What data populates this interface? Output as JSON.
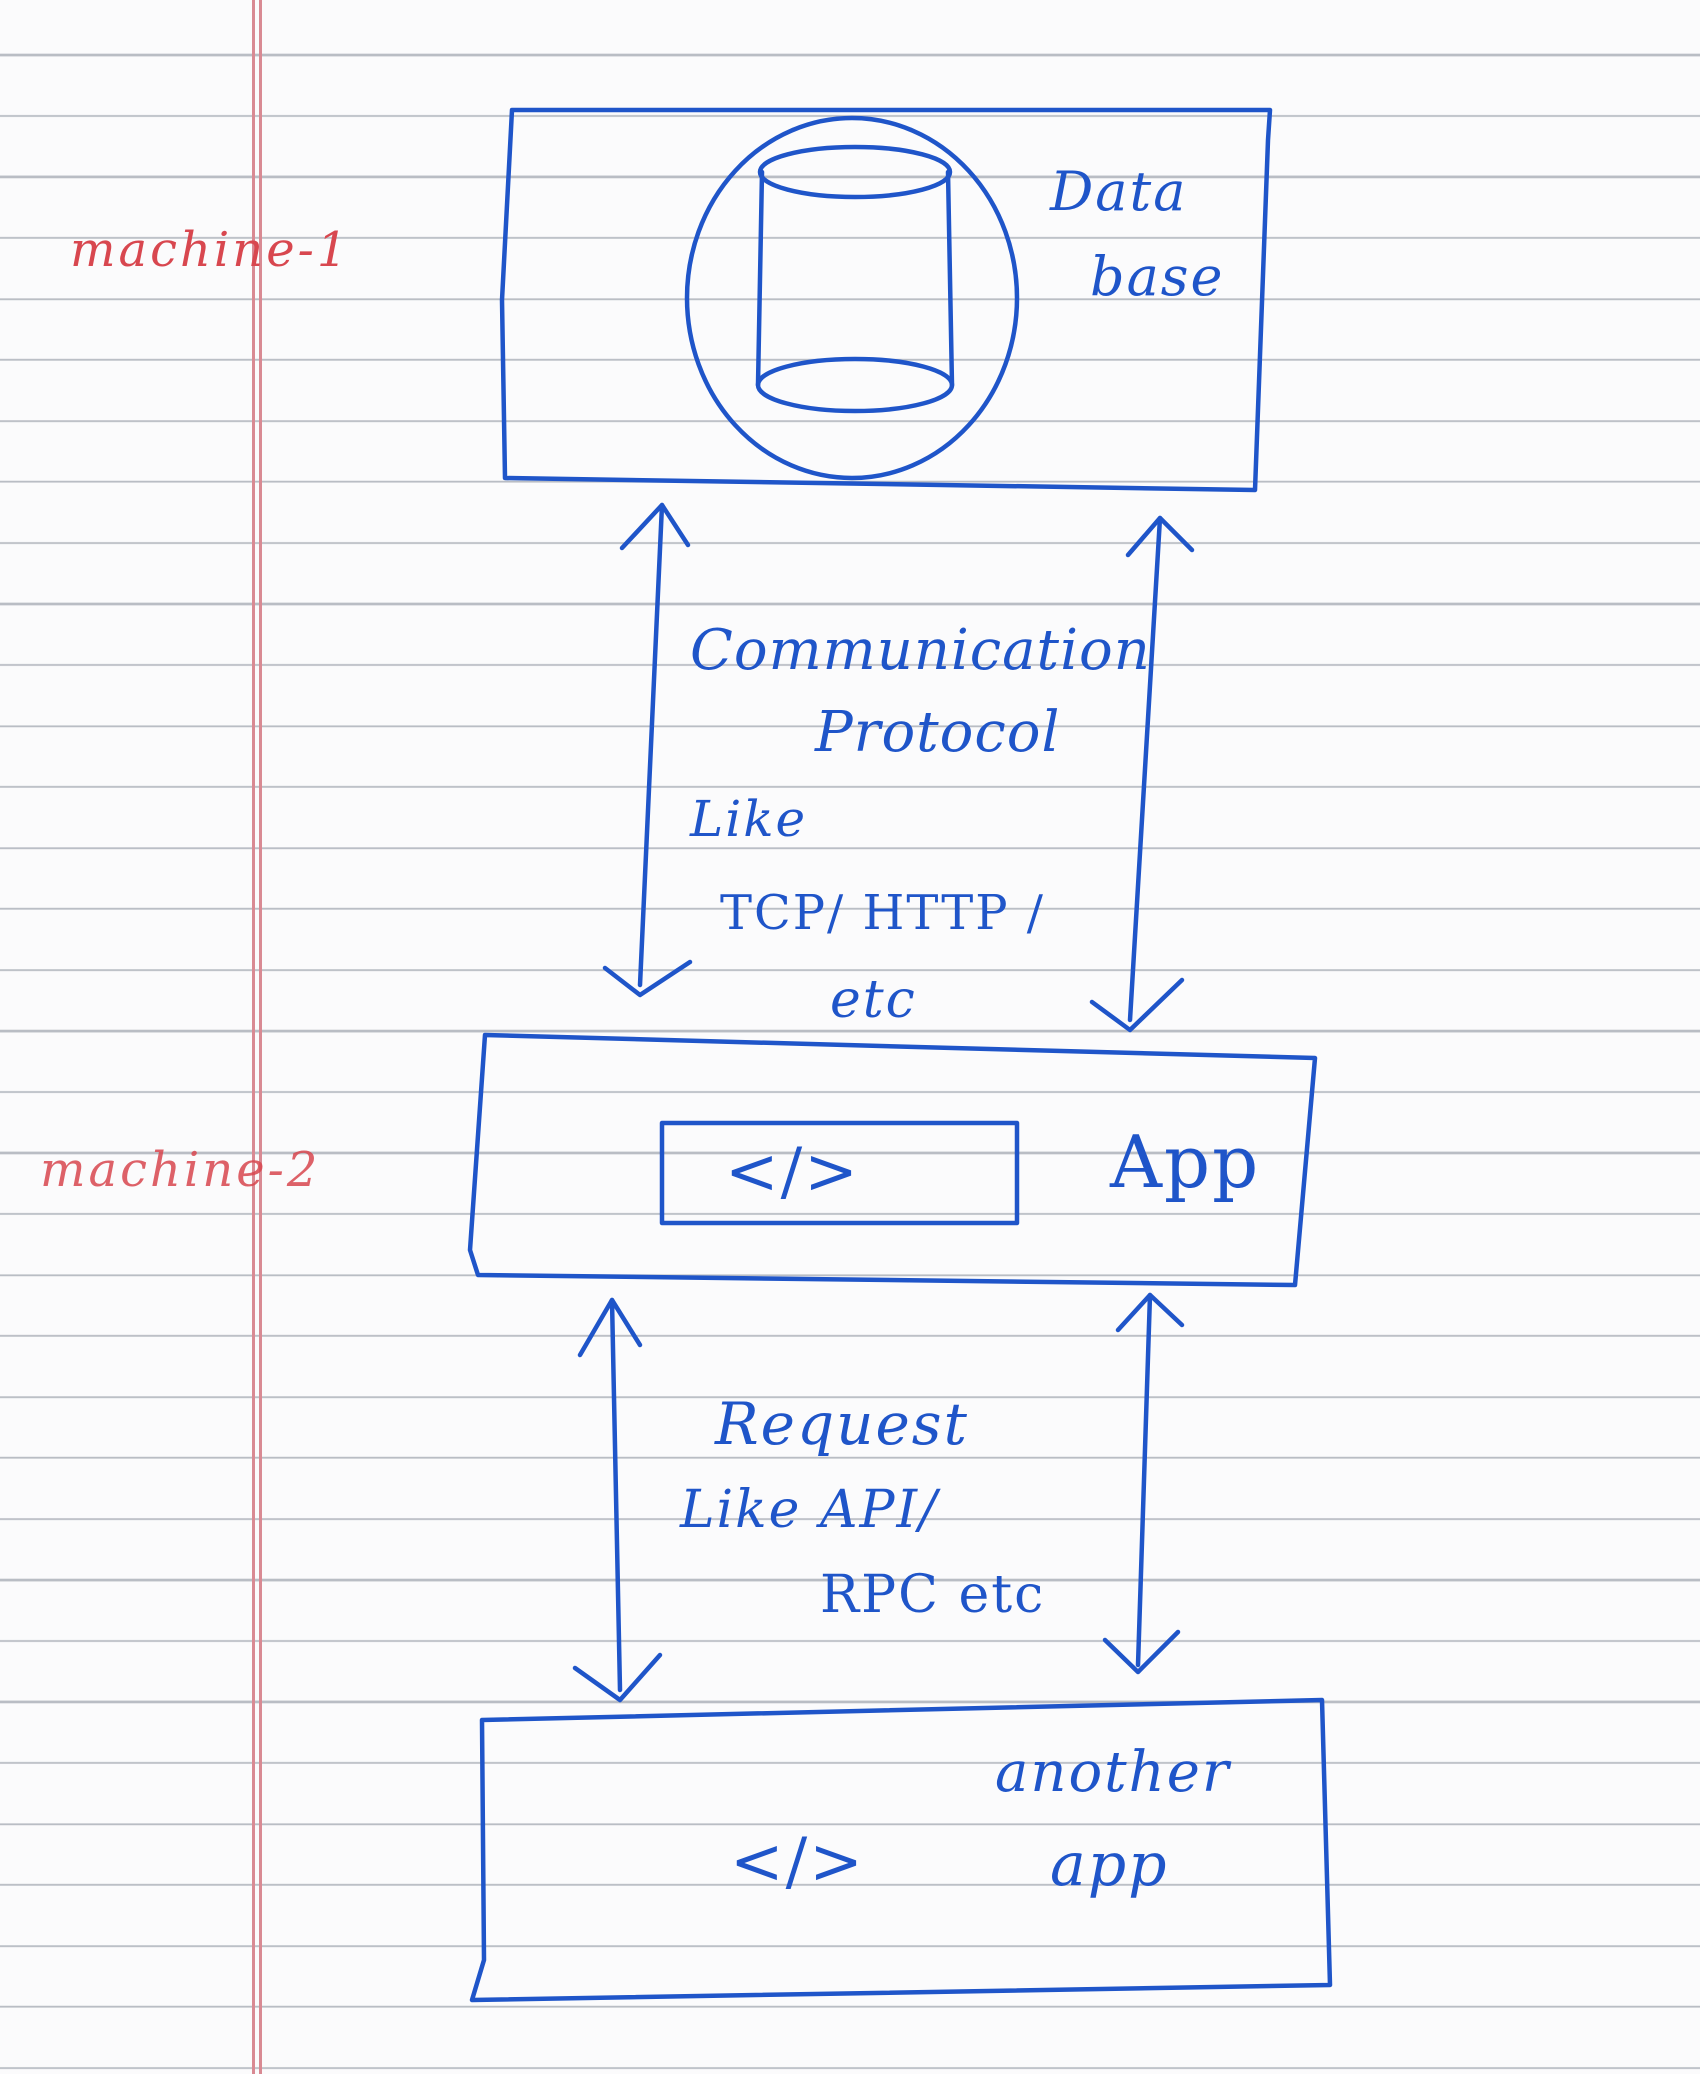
{
  "machines": {
    "machine_1_label": "machine-1",
    "machine_2_label": "machine-2"
  },
  "database_box": {
    "icon": "database-cylinder-icon",
    "label_line1": "Data",
    "label_line2": "base"
  },
  "top_connection": {
    "line1": "Communication",
    "line2": "Protocol",
    "line3": "Like",
    "line4": "TCP/ HTTP /",
    "line5": "etc"
  },
  "app_box": {
    "code_icon": "</>",
    "label": "App"
  },
  "bottom_connection": {
    "line1": "Request",
    "line2": "Like API/",
    "line3": "RPC etc"
  },
  "another_app_box": {
    "code_icon": "</>",
    "label_line1": "another",
    "label_line2": "app"
  },
  "colors": {
    "ink": "#1f55c9",
    "margin_ink": "#d8474f",
    "ruled_line": "#b9bdc4",
    "paper": "#fbfbfc"
  }
}
